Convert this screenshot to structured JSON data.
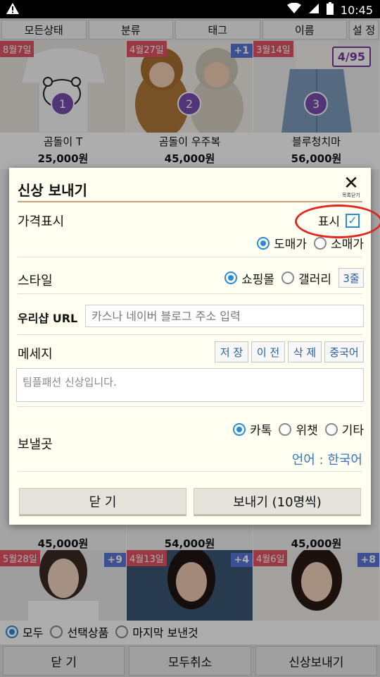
{
  "status_bar": {
    "time": "10:45"
  },
  "tabs": [
    "모든상태",
    "분류",
    "태그",
    "이름",
    "설 정"
  ],
  "counter": "4/95",
  "products_top": [
    {
      "date": "8월7일",
      "number": "1",
      "name": "곰돌이 T",
      "price": "25,000원"
    },
    {
      "date": "4월27일",
      "plus": "+1",
      "number": "2",
      "name": "곰돌이 우주복",
      "price": "45,000원"
    },
    {
      "date": "3월14일",
      "number": "3",
      "name": "블루청치마",
      "price": "56,000원"
    }
  ],
  "products_mid": [
    {
      "price": "45,000원"
    },
    {
      "price": "54,000원"
    },
    {
      "price": "45,000원"
    }
  ],
  "products_bottom": [
    {
      "date": "5월28일",
      "plus": "+9"
    },
    {
      "date": "4월13일",
      "plus": "+4"
    },
    {
      "date": "4월6일",
      "plus": "+8"
    }
  ],
  "bottom_radios": [
    {
      "label": "모두",
      "selected": true
    },
    {
      "label": "선택상품",
      "selected": false
    },
    {
      "label": "마지막 보낸것",
      "selected": false
    }
  ],
  "bottom_buttons": [
    "닫 기",
    "모두취소",
    "신상보내기"
  ],
  "dialog": {
    "title": "신상 보내기",
    "close_label": "목록닫기",
    "price": {
      "label": "가격표시",
      "show_label": "표시",
      "show_checked": true,
      "options": [
        {
          "label": "도매가",
          "selected": true
        },
        {
          "label": "소매가",
          "selected": false
        }
      ]
    },
    "style": {
      "label": "스타일",
      "options": [
        {
          "label": "쇼핑몰",
          "selected": true
        },
        {
          "label": "갤러리",
          "selected": false
        }
      ],
      "rows_button": "3줄"
    },
    "url": {
      "label": "우리샵 URL",
      "placeholder": "카스나 네이버 블로그 주소 입력"
    },
    "message": {
      "label": "메세지",
      "buttons": [
        "저 장",
        "이 전",
        "삭 제",
        "중국어"
      ],
      "placeholder": "팀플패션 신상입니다."
    },
    "send_to": {
      "label": "보낼곳",
      "options": [
        {
          "label": "카톡",
          "selected": true
        },
        {
          "label": "위챗",
          "selected": false
        },
        {
          "label": "기타",
          "selected": false
        }
      ],
      "language": "언어 : 한국어"
    },
    "close_button": "닫  기",
    "send_button": "보내기 (10명씩)"
  }
}
